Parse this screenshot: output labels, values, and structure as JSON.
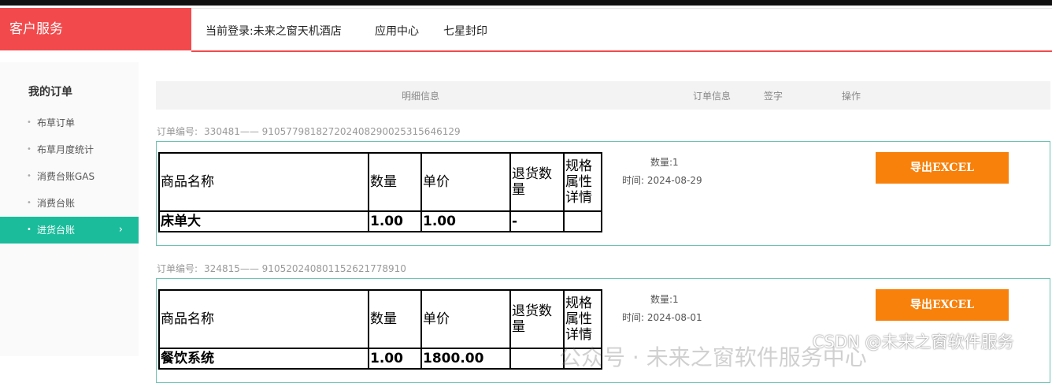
{
  "header": {
    "brand": "客户服务",
    "current_login": "当前登录:未来之窗天机酒店",
    "nav": [
      "应用中心",
      "七星封印"
    ]
  },
  "sidebar": {
    "title": "我的订单",
    "items": [
      {
        "label": "布草订单",
        "active": false
      },
      {
        "label": "布草月度统计",
        "active": false
      },
      {
        "label": "消费台账GAS",
        "active": false
      },
      {
        "label": "消费台账",
        "active": false
      },
      {
        "label": "进货台账",
        "active": true
      }
    ],
    "active_chevron": "›"
  },
  "table_header": {
    "detail": "明细信息",
    "order_info": "订单信息",
    "sign": "签字",
    "action": "操作"
  },
  "order_no_label": "订单编号:",
  "columns": [
    "商品名称",
    "数量",
    "单价",
    "退货数量",
    "规格属性详情"
  ],
  "orders": [
    {
      "number": "330481—— 910577981827202408290025315646129",
      "rows": [
        [
          "床单大",
          "1.00",
          "1.00",
          "-",
          ""
        ]
      ],
      "qty_label": "数量:1",
      "time_label": "时间: 2024-08-29",
      "button": "导出EXCEL"
    },
    {
      "number": "324815—— 910520240801152621778910",
      "rows": [
        [
          "餐饮系统",
          "1.00",
          "1800.00",
          "",
          ""
        ]
      ],
      "qty_label": "数量:1",
      "time_label": "时间: 2024-08-01",
      "button": "导出EXCEL"
    }
  ],
  "watermark": {
    "csdn": "CSDN @未来之窗软件服务",
    "wechat": "公众号 · 未来之窗软件服务中心"
  },
  "colors": {
    "brand_red": "#f24a4c",
    "active_teal": "#1bbc9b",
    "order_border": "#6cc2b3",
    "button_orange": "#f7810b"
  },
  "icons": [
    "chevron-right-icon",
    "bullet-dot-icon"
  ]
}
